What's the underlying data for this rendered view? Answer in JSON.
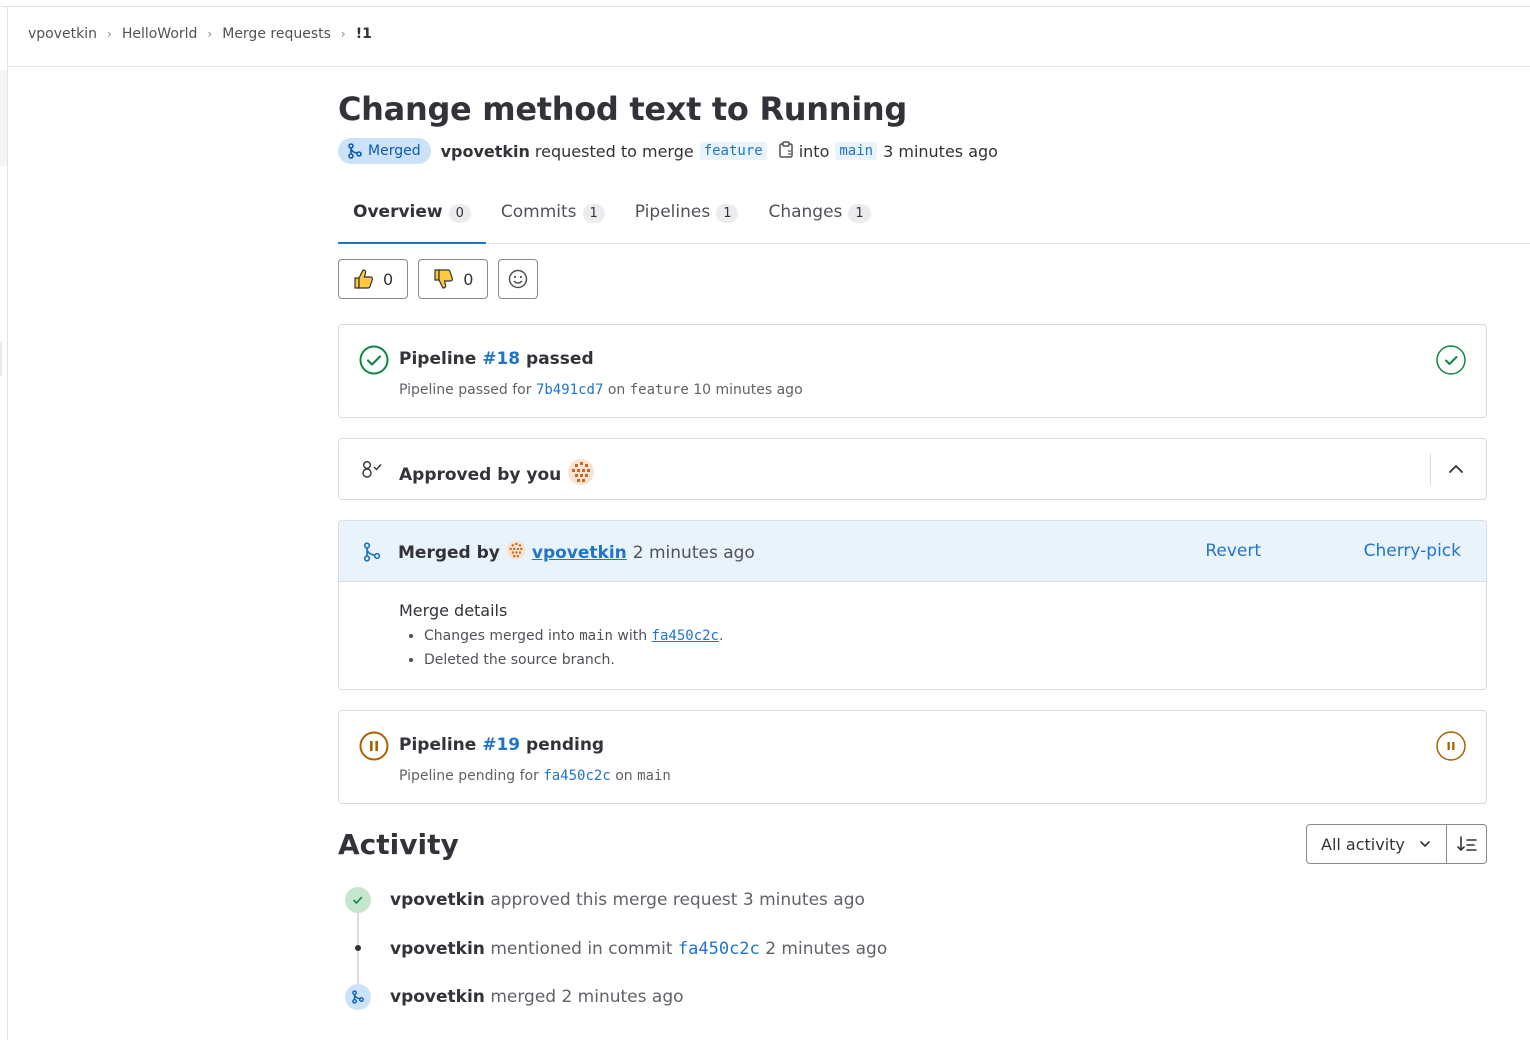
{
  "breadcrumb": {
    "items": [
      "vpovetkin",
      "HelloWorld",
      "Merge requests"
    ],
    "current": "!1"
  },
  "mr": {
    "title": "Change method text to Running",
    "status_badge": "Merged",
    "author": "vpovetkin",
    "requested_text": "requested to merge",
    "source_branch": "feature",
    "into_text": "into",
    "target_branch": "main",
    "time": "3 minutes ago"
  },
  "tabs": [
    {
      "label": "Overview",
      "count": "0"
    },
    {
      "label": "Commits",
      "count": "1"
    },
    {
      "label": "Pipelines",
      "count": "1"
    },
    {
      "label": "Changes",
      "count": "1"
    }
  ],
  "reactions": {
    "thumbs_up": "0",
    "thumbs_down": "0"
  },
  "pipeline1": {
    "label": "Pipeline",
    "id": "#18",
    "status": "passed",
    "sub_prefix": "Pipeline passed for",
    "commit": "7b491cd7",
    "on_text": "on",
    "branch": "feature",
    "time": "10 minutes ago"
  },
  "approval": {
    "text": "Approved by you"
  },
  "merged": {
    "label": "Merged by",
    "user": "vpovetkin",
    "time": "2 minutes ago",
    "revert": "Revert",
    "cherry_pick": "Cherry-pick",
    "details_title": "Merge details",
    "detail1_prefix": "Changes merged into",
    "detail1_branch": "main",
    "detail1_with": "with",
    "detail1_commit": "fa450c2c",
    "detail1_end": ".",
    "detail2": "Deleted the source branch."
  },
  "pipeline2": {
    "label": "Pipeline",
    "id": "#19",
    "status": "pending",
    "sub_prefix": "Pipeline pending for",
    "commit": "fa450c2c",
    "on_text": "on",
    "branch": "main"
  },
  "activity": {
    "title": "Activity",
    "filter": "All activity",
    "items": [
      {
        "user": "vpovetkin",
        "text": "approved this merge request 3 minutes ago"
      },
      {
        "user": "vpovetkin",
        "text": "mentioned in commit",
        "commit": "fa450c2c",
        "time": "2 minutes ago"
      },
      {
        "user": "vpovetkin",
        "text": "merged 2 minutes ago"
      }
    ]
  },
  "colors": {
    "link": "#1f75cb",
    "success": "#108548",
    "pending": "#ab6100",
    "merged_badge_bg": "#cbe2f9"
  }
}
